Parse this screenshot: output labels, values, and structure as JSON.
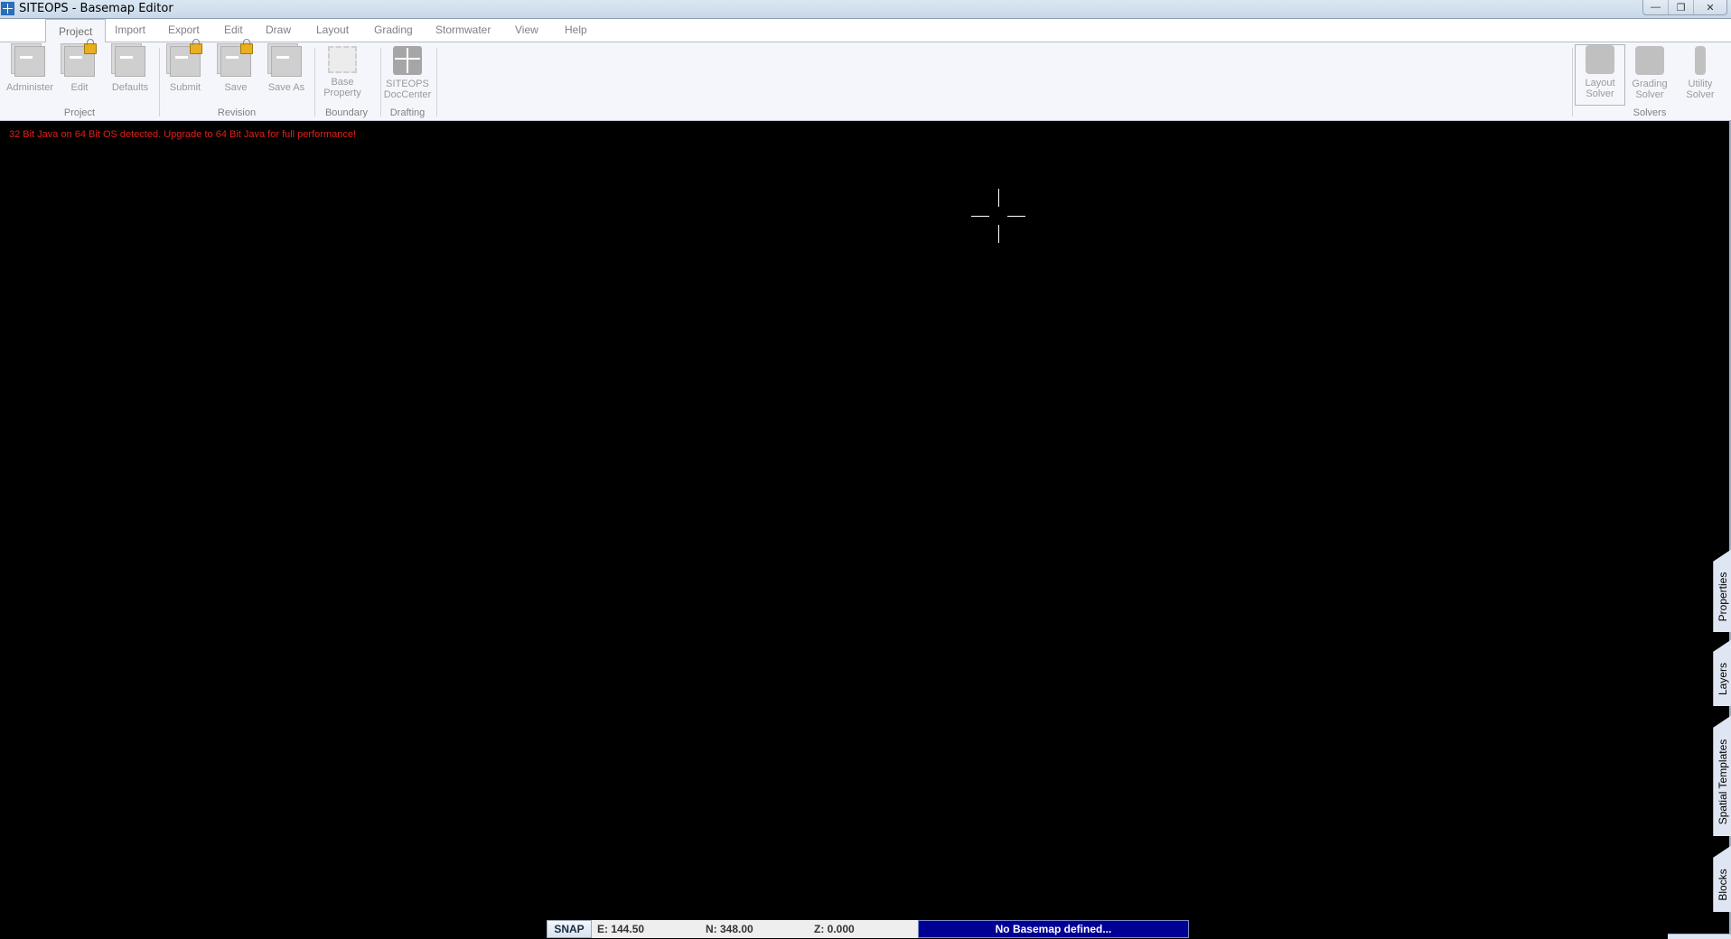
{
  "window": {
    "title": "SITEOPS - Basemap Editor",
    "buttons": {
      "minimize": "—",
      "restore": "❐",
      "close": "✕"
    }
  },
  "menu_tabs": [
    {
      "label": "Project",
      "active": true
    },
    {
      "label": "Import"
    },
    {
      "label": "Export"
    },
    {
      "label": "Edit"
    },
    {
      "label": "Draw"
    },
    {
      "label": "Layout"
    },
    {
      "label": "Grading"
    },
    {
      "label": "Stormwater"
    },
    {
      "label": "View"
    },
    {
      "label": "Help"
    }
  ],
  "ribbon": {
    "groups": {
      "project": {
        "label": "Project",
        "buttons": [
          {
            "label": "Administer",
            "icon": "document-stack-icon"
          },
          {
            "label": "Edit",
            "icon": "document-lock-icon"
          },
          {
            "label": "Defaults",
            "icon": "document-defaults-icon"
          }
        ]
      },
      "revision": {
        "label": "Revision",
        "buttons": [
          {
            "label": "Submit",
            "icon": "submit-lock-icon"
          },
          {
            "label": "Save",
            "icon": "save-lock-icon"
          },
          {
            "label": "Save As",
            "icon": "save-as-icon"
          }
        ]
      },
      "boundary": {
        "label": "Boundary",
        "buttons": [
          {
            "label_line1": "Base",
            "label_line2": "Property",
            "icon": "boundary-frame-icon"
          }
        ]
      },
      "drafting": {
        "label": "Drafting",
        "buttons": [
          {
            "label_line1": "SITEOPS",
            "label_line2": "DocCenter",
            "icon": "doccenter-grid-icon"
          }
        ]
      },
      "solvers": {
        "label": "Solvers",
        "buttons": [
          {
            "label_line1": "Layout",
            "label_line2": "Solver",
            "icon": "car-icon"
          },
          {
            "label_line1": "Grading",
            "label_line2": "Solver",
            "icon": "bulldozer-icon"
          },
          {
            "label_line1": "Utility",
            "label_line2": "Solver",
            "icon": "pipe-icon"
          }
        ]
      }
    }
  },
  "canvas": {
    "warning": "32 Bit Java on 64 Bit OS detected. Upgrade to 64 Bit Java for full performance!",
    "warning_color": "#e0201a",
    "background": "#000000"
  },
  "side_tabs": [
    "Properties",
    "Layers",
    "Spatial Templates",
    "Blocks"
  ],
  "status": {
    "snap_label": "SNAP",
    "easting": "E: 144.50",
    "northing": "N: 348.00",
    "elevation": "Z: 0.000",
    "basemap_message": "No Basemap defined...",
    "basemap_color": "#000094"
  }
}
